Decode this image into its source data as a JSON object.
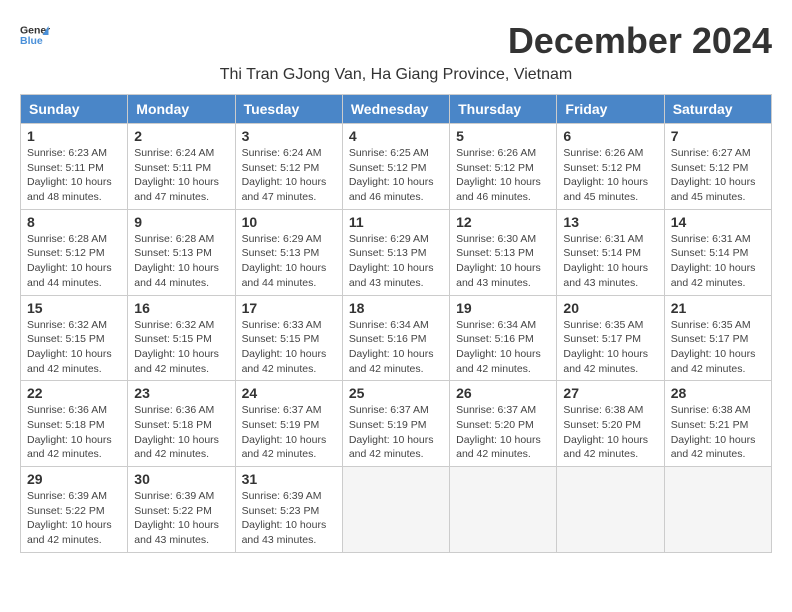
{
  "header": {
    "logo_general": "General",
    "logo_blue": "Blue",
    "month_title": "December 2024",
    "location": "Thi Tran GJong Van, Ha Giang Province, Vietnam"
  },
  "calendar": {
    "days_of_week": [
      "Sunday",
      "Monday",
      "Tuesday",
      "Wednesday",
      "Thursday",
      "Friday",
      "Saturday"
    ],
    "weeks": [
      [
        null,
        null,
        null,
        null,
        null,
        null,
        null
      ]
    ],
    "cells": [
      {
        "day": null
      },
      {
        "day": null
      },
      {
        "day": null
      },
      {
        "day": null
      },
      {
        "day": null
      },
      {
        "day": null
      },
      {
        "day": null
      }
    ]
  }
}
